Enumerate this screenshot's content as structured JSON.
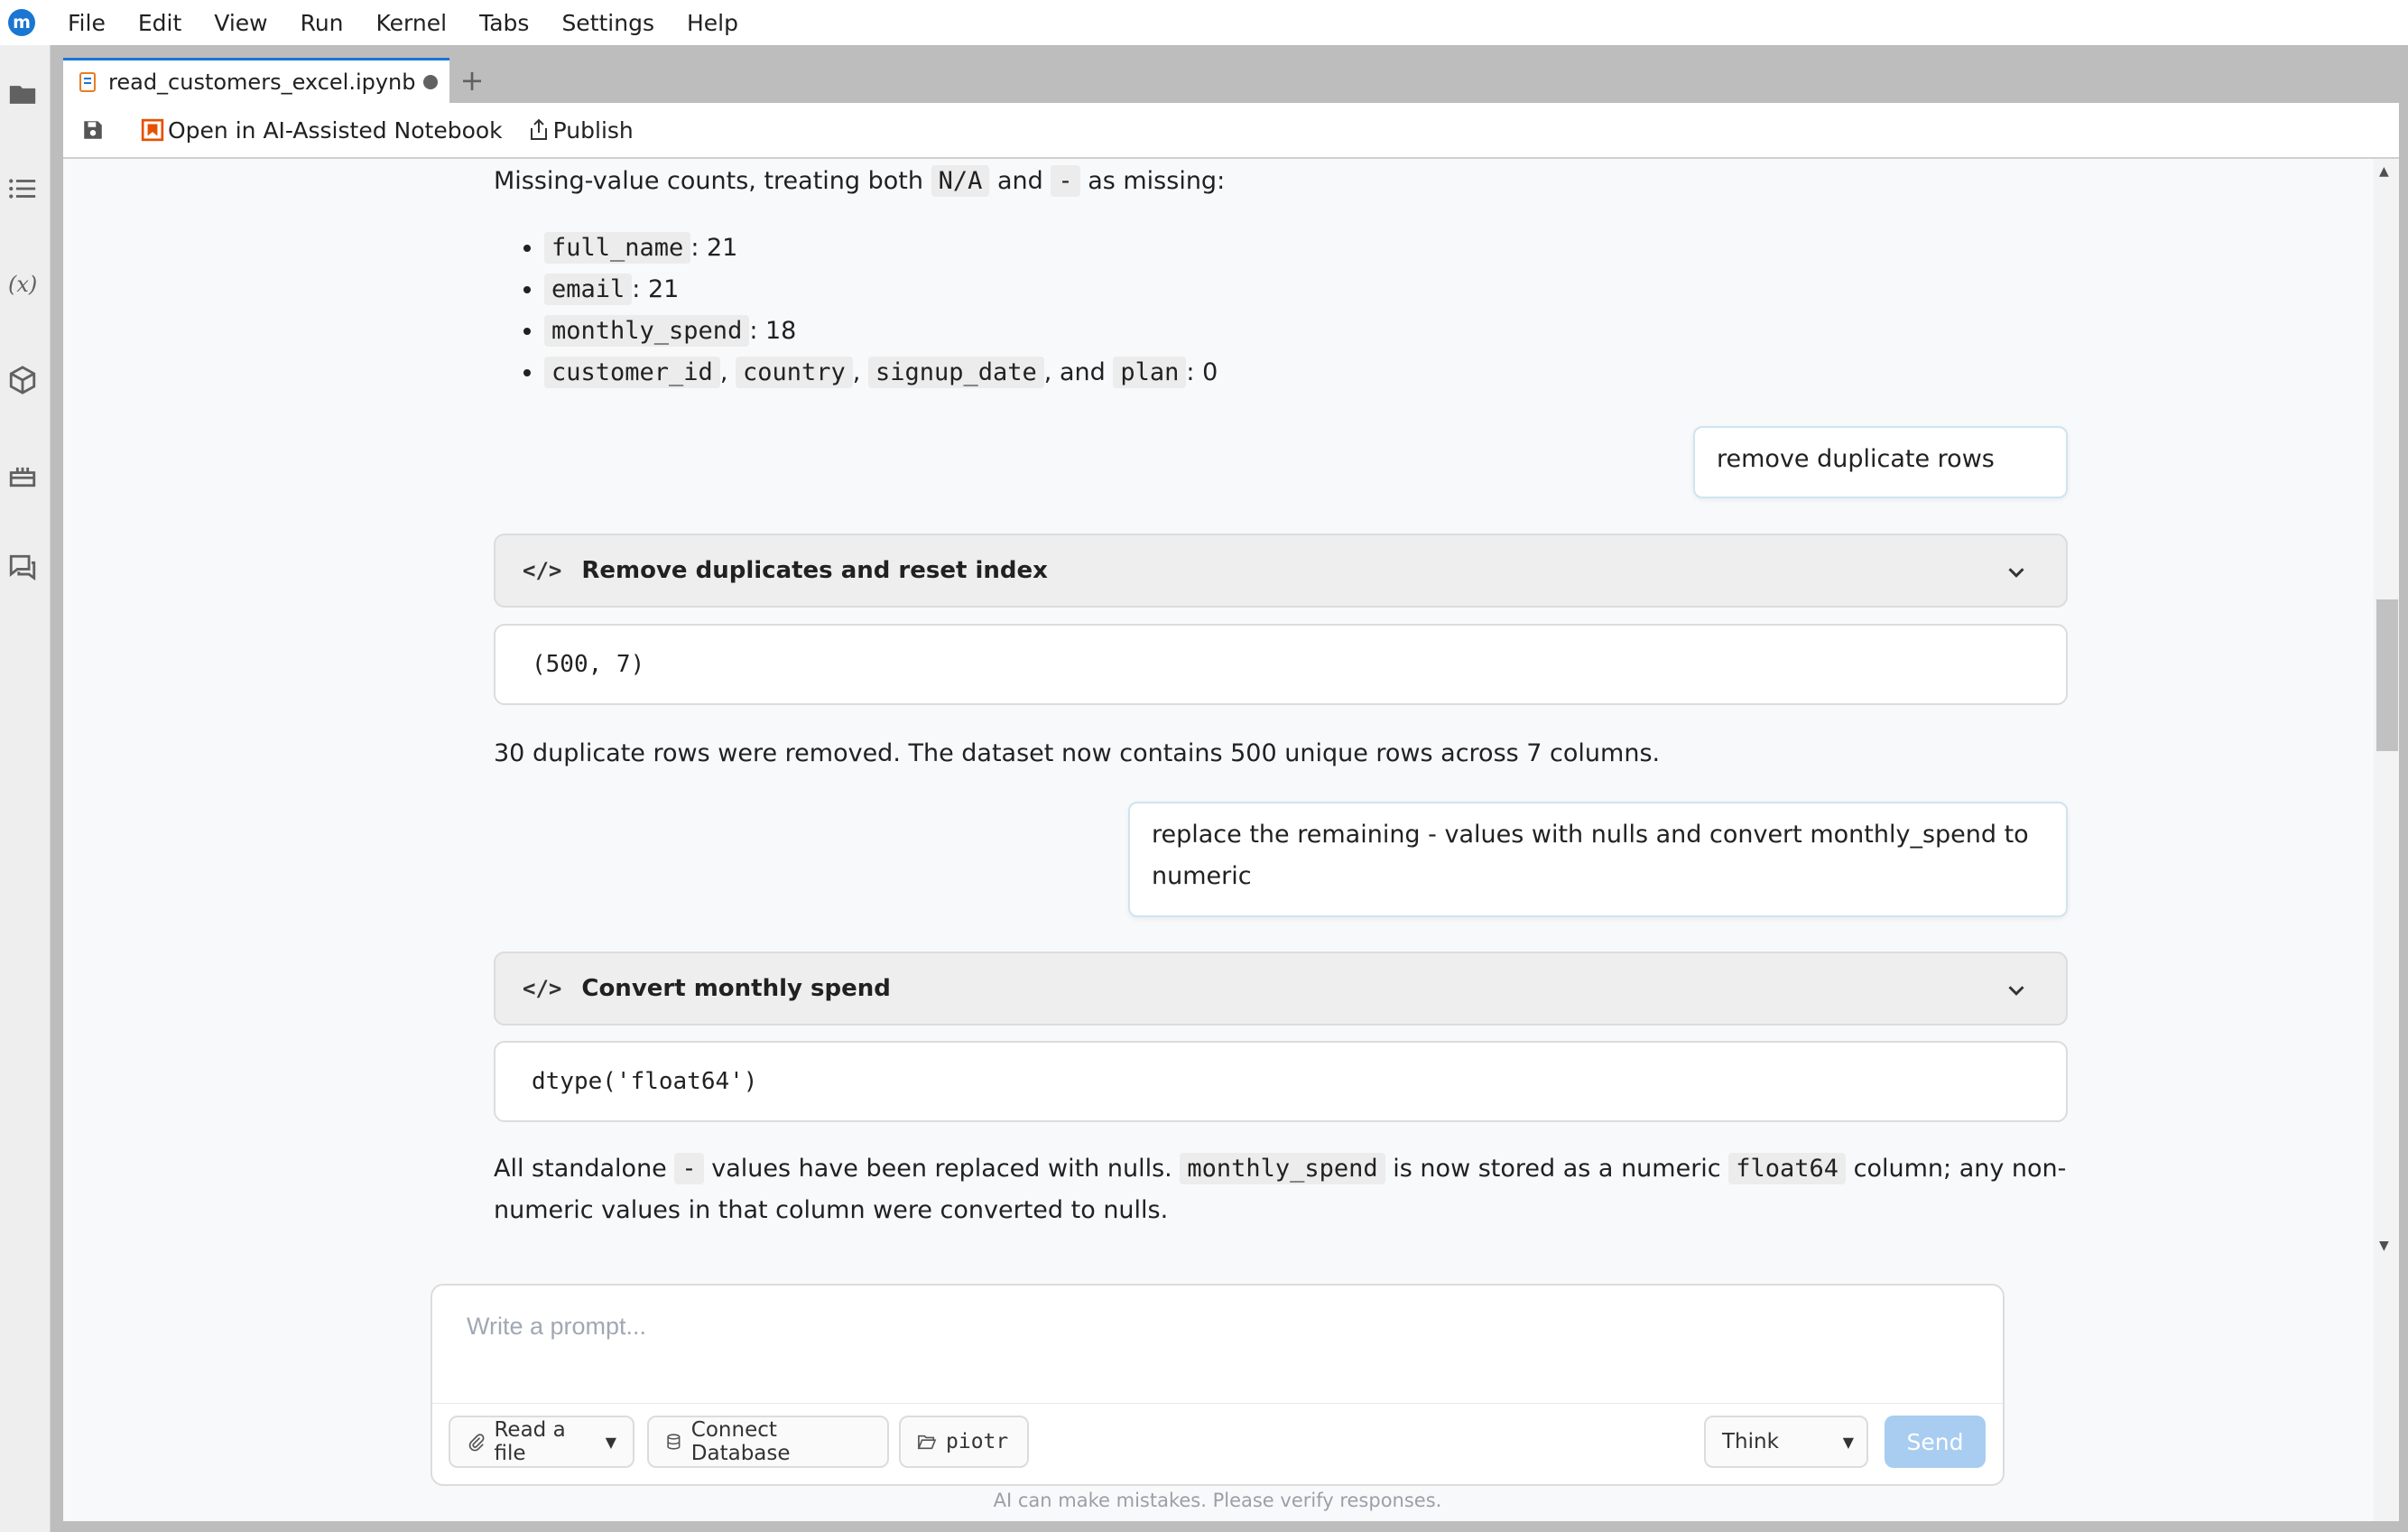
{
  "menu": [
    "File",
    "Edit",
    "View",
    "Run",
    "Kernel",
    "Tabs",
    "Settings",
    "Help"
  ],
  "logo_letter": "m",
  "sidebar_icons": [
    "folder-icon",
    "list-icon",
    "variables-icon",
    "package-icon",
    "cake-icon",
    "chat-icon"
  ],
  "tab": {
    "label": "read_customers_excel.ipynb",
    "new_tab": "+"
  },
  "toolbar": {
    "ai_notebook_label": "Open in AI-Assisted Notebook",
    "publish_label": "Publish"
  },
  "chat": {
    "missing_intro_a": "Missing-value counts, treating both",
    "missing_code_1": "N/A",
    "missing_intro_b": "and",
    "missing_code_2": "-",
    "missing_intro_c": "as missing:",
    "missing_items": [
      {
        "code": "full_name",
        "count": ": 21"
      },
      {
        "code": "email",
        "count": ": 21"
      },
      {
        "code": "monthly_spend",
        "count": ": 18"
      }
    ],
    "missing_last": {
      "code_a": "customer_id",
      "sep1": ",",
      "code_b": "country",
      "sep2": ",",
      "code_c": "signup_date",
      "and": ", and",
      "code_d": "plan",
      "count": ": 0"
    },
    "user_msg_1": "remove duplicate rows",
    "step_1_tag": "</>",
    "step_1_title": "Remove duplicates and reset index",
    "output_1": "(500, 7)",
    "result_1": "30 duplicate rows were removed. The dataset now contains 500 unique rows across 7 columns.",
    "user_msg_2": "replace the remaining - values with nulls and convert monthly_spend to numeric",
    "step_2_tag": "</>",
    "step_2_title": "Convert monthly spend",
    "output_2": "dtype('float64')",
    "result_2": {
      "a": "All standalone",
      "code_1": "-",
      "b": "values have been replaced with nulls.",
      "code_2": "monthly_spend",
      "c": "is now stored as a numeric",
      "code_3": "float64",
      "d": "column; any non-numeric values in that column were converted to nulls."
    }
  },
  "prompt": {
    "placeholder": "Write a prompt...",
    "read_file": "Read a file",
    "connect_db": "Connect Database",
    "folder": "piotr",
    "think": "Think",
    "send": "Send",
    "disclaimer": "AI can make mistakes. Please verify responses."
  },
  "colors": {
    "accent": "#1976d2",
    "send_disabled": "#a8cdf0",
    "user_bubble_border": "#cfe4f0"
  }
}
